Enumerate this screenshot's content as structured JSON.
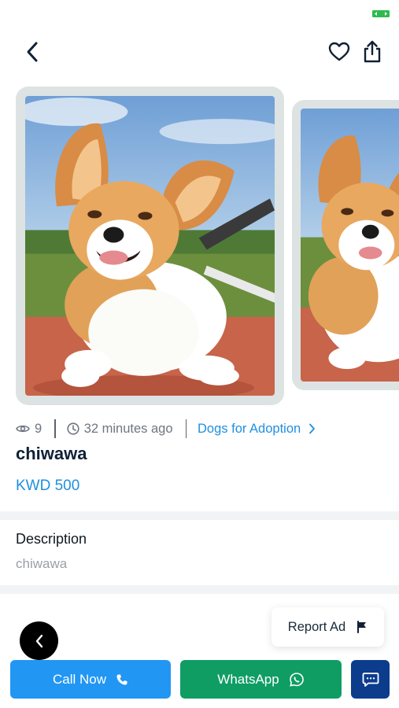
{
  "colors": {
    "accent_blue": "#1f8fe0",
    "call_button": "#2196f3",
    "whatsapp_button": "#0f9d64",
    "chat_button": "#0c3c8c",
    "title_text": "#0f2135",
    "muted_text": "#6d7680",
    "card_frame": "#dde3e2"
  },
  "icons": {
    "back": "chevron-left-icon",
    "favorite": "heart-icon",
    "share": "share-icon",
    "views": "eye-icon",
    "time": "clock-icon",
    "category_arrow": "chevron-right-icon",
    "report": "flag-icon",
    "call": "phone-icon",
    "whatsapp": "whatsapp-icon",
    "chat": "chat-icon"
  },
  "gallery": {
    "images": [
      "chihuahua-photo-1",
      "chihuahua-photo-2"
    ]
  },
  "listing": {
    "views": "9",
    "posted": "32 minutes ago",
    "category": "Dogs for Adoption",
    "title": "chiwawa",
    "price": "KWD 500"
  },
  "description": {
    "heading": "Description",
    "text": "chiwawa"
  },
  "actions": {
    "report_label": "Report Ad",
    "call_label": "Call Now",
    "whatsapp_label": "WhatsApp"
  }
}
